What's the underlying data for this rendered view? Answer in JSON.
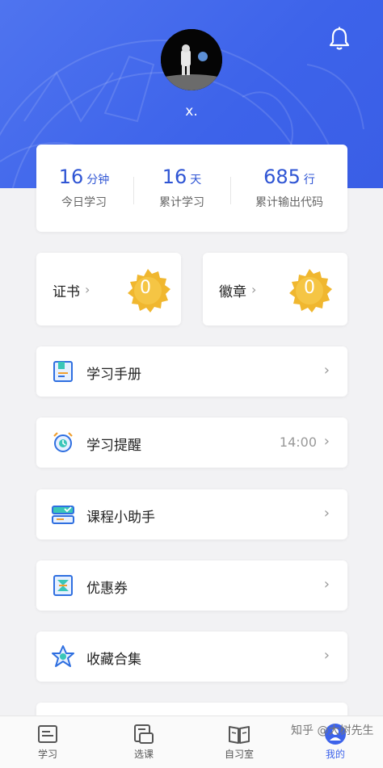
{
  "profile": {
    "username": "x."
  },
  "stats": [
    {
      "value": "16",
      "unit": "分钟",
      "label": "今日学习"
    },
    {
      "value": "16",
      "unit": "天",
      "label": "累计学习"
    },
    {
      "value": "685",
      "unit": "行",
      "label": "累计输出代码"
    }
  ],
  "awards": [
    {
      "label": "证书",
      "count": "0"
    },
    {
      "label": "徽章",
      "count": "0"
    }
  ],
  "menu": [
    {
      "label": "学习手册"
    },
    {
      "label": "学习提醒",
      "value": "14:00"
    },
    {
      "label": "课程小助手"
    },
    {
      "label": "优惠券"
    },
    {
      "label": "收藏合集"
    }
  ],
  "tabs": [
    {
      "label": "学习"
    },
    {
      "label": "选课"
    },
    {
      "label": "自习室"
    },
    {
      "label": "我的"
    }
  ],
  "watermark": "知乎 @大树先生",
  "colors": {
    "primary": "#3d63ea",
    "accent_gold": "#f0b72f",
    "stat_blue": "#2f55d4"
  },
  "icons": [
    "bell-icon",
    "handbook-icon",
    "alarm-clock-icon",
    "assistant-icon",
    "coupon-icon",
    "star-collection-icon"
  ]
}
